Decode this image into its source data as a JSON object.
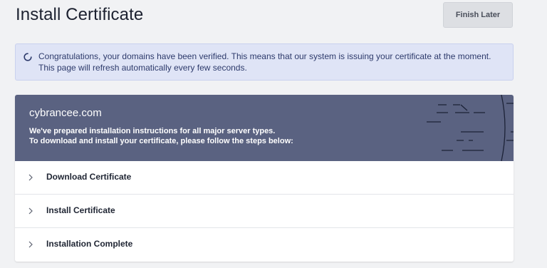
{
  "page": {
    "title": "Install Certificate",
    "finish_later_label": "Finish Later"
  },
  "alert": {
    "icon": "spinner-icon",
    "message": "Congratulations, your domains have been verified. This means that our system is issuing your certificate at the moment. This page will refresh automatically every few seconds."
  },
  "card": {
    "domain": "cybrancee.com",
    "description_line1": "We've prepared installation instructions for all major server types.",
    "description_line2": "To download and install your certificate, please follow the steps below:",
    "steps": [
      {
        "label": "Download Certificate",
        "icon": "chevron-right-icon"
      },
      {
        "label": "Install Certificate",
        "icon": "chevron-right-icon"
      },
      {
        "label": "Installation Complete",
        "icon": "chevron-right-icon"
      }
    ]
  },
  "colors": {
    "background": "#f1f2f4",
    "alert_bg": "#dfe4f6",
    "card_header_bg": "#5a6281",
    "accent_text": "#2d3a6b"
  }
}
